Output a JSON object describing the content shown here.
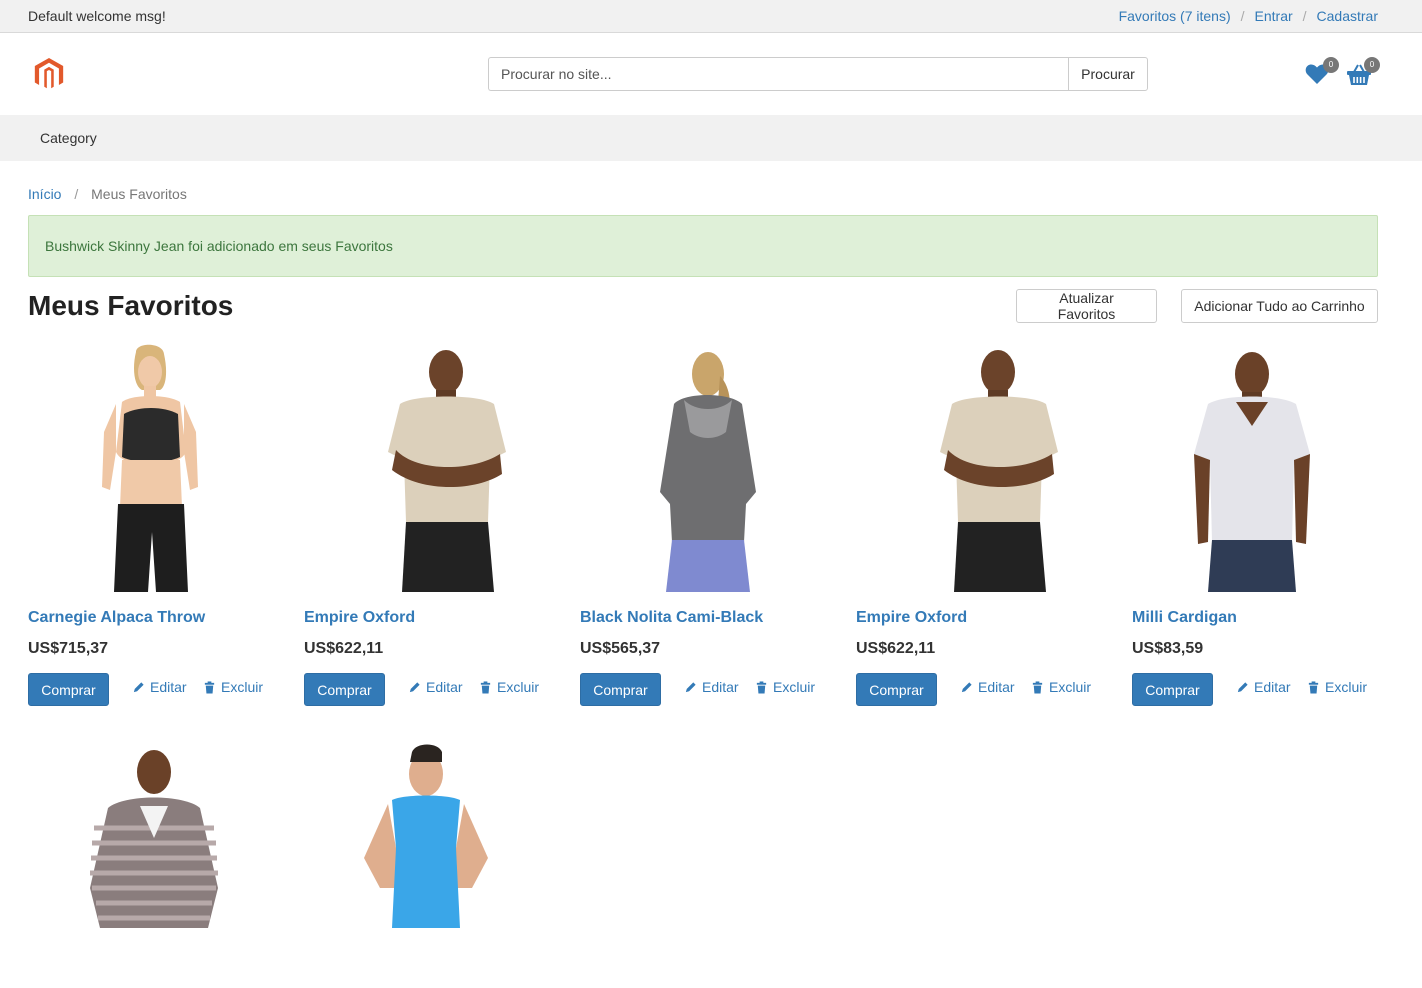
{
  "topbar": {
    "welcome": "Default welcome msg!",
    "favorites_link": "Favoritos (7 itens)",
    "login_link": "Entrar",
    "register_link": "Cadastrar",
    "separator": "/"
  },
  "header": {
    "search_placeholder": "Procurar no site...",
    "search_button": "Procurar",
    "wishlist_count": "0",
    "cart_count": "0"
  },
  "nav": {
    "category": "Category"
  },
  "breadcrumb": {
    "home": "Início",
    "separator": "/",
    "current": "Meus Favoritos"
  },
  "alert": {
    "message": "Bushwick Skinny Jean foi adicionado em seus Favoritos"
  },
  "page": {
    "title": "Meus Favoritos",
    "update_button": "Atualizar Favoritos",
    "add_all_button": "Adicionar Tudo ao Carrinho"
  },
  "item_actions": {
    "buy": "Comprar",
    "edit": "Editar",
    "remove": "Excluir"
  },
  "items": [
    {
      "name": "Carnegie Alpaca Throw",
      "price": "US$715,37",
      "image": "woman-black-sports-bra"
    },
    {
      "name": "Empire Oxford",
      "price": "US$622,11",
      "image": "man-beige-tee"
    },
    {
      "name": "Black Nolita Cami-Black",
      "price": "US$565,37",
      "image": "woman-gray-hoodie-back"
    },
    {
      "name": "Empire Oxford",
      "price": "US$622,11",
      "image": "man-beige-tee"
    },
    {
      "name": "Milli Cardigan",
      "price": "US$83,59",
      "image": "man-white-vneck"
    },
    {
      "name": "",
      "price": "",
      "image": "man-striped-hoodie"
    },
    {
      "name": "",
      "price": "",
      "image": "man-blue-tank"
    }
  ],
  "colors": {
    "brand": "#337ab7",
    "logo": "#e2592b",
    "alert_bg": "#dff0d8",
    "alert_text": "#3c763d"
  }
}
